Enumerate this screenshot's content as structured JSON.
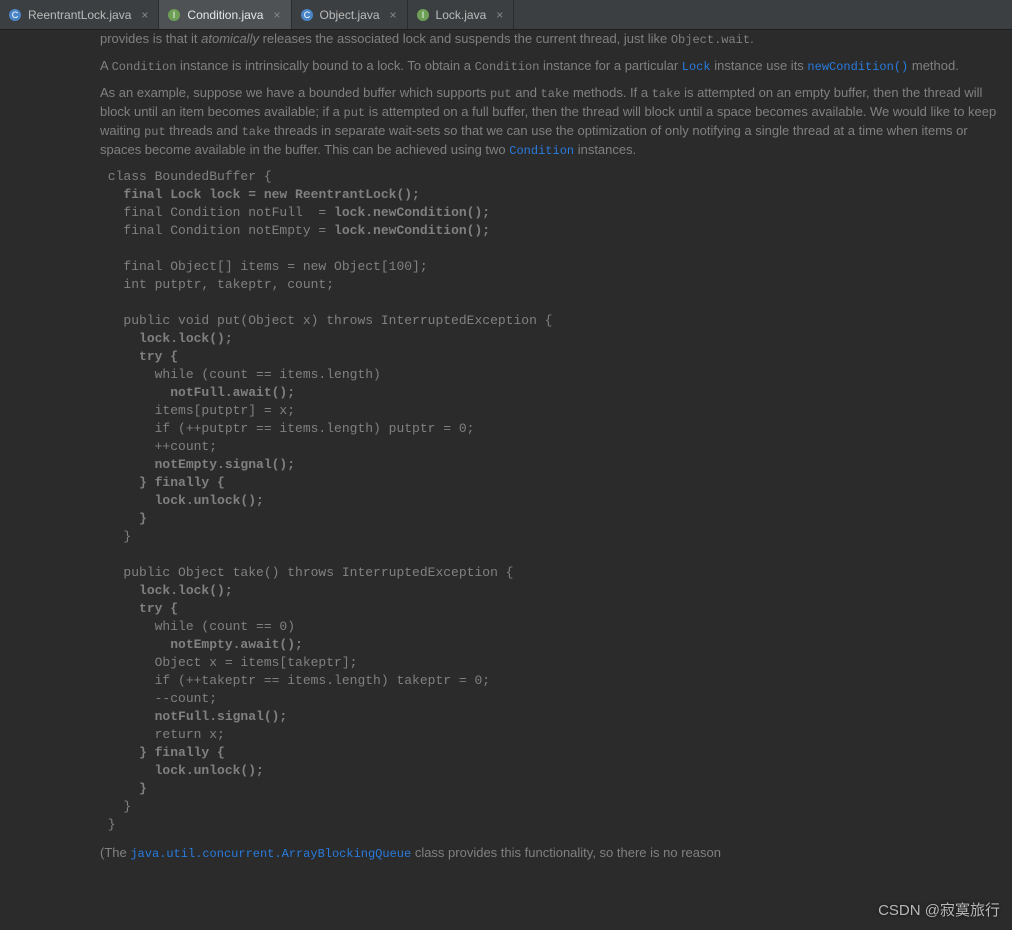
{
  "tabs": [
    {
      "label": "ReentrantLock.java",
      "icon": "class",
      "color": "#4A86C7"
    },
    {
      "label": "Condition.java",
      "icon": "interface",
      "color": "#6E9F56"
    },
    {
      "label": "Object.java",
      "icon": "class",
      "color": "#4A86C7"
    },
    {
      "label": "Lock.java",
      "icon": "interface",
      "color": "#6E9F56"
    }
  ],
  "doc": {
    "p1_a": "provides is that it ",
    "p1_em": "atomically",
    "p1_b": " releases the associated lock and suspends the current thread, just like ",
    "p1_mono": "Object.wait",
    "p1_c": ".",
    "p2_a": "A ",
    "p2_m1": "Condition",
    "p2_b": " instance is intrinsically bound to a lock. To obtain a ",
    "p2_m2": "Condition",
    "p2_c": " instance for a particular ",
    "p2_link": "Lock",
    "p2_d": " instance use its ",
    "p2_link2": "newCondition()",
    "p2_e": " method.",
    "p3_a": "As an example, suppose we have a bounded buffer which supports ",
    "p3_m1": "put",
    "p3_b": " and ",
    "p3_m2": "take",
    "p3_c": " methods. If a ",
    "p3_m3": "take",
    "p3_d": " is attempted on an empty buffer, then the thread will block until an item becomes available; if a ",
    "p3_m4": "put",
    "p3_e": " is attempted on a full buffer, then the thread will block until a space becomes available. We would like to keep waiting ",
    "p3_m5": "put",
    "p3_f": " threads and ",
    "p3_m6": "take",
    "p3_g": " threads in separate wait-sets so that we can use the optimization of only notifying a single thread at a time when items or spaces become available in the buffer. This can be achieved using two ",
    "p3_link": "Condition",
    "p3_h": " instances.",
    "foot_a": "(The ",
    "foot_link": "java.util.concurrent.ArrayBlockingQueue",
    "foot_b": " class provides this functionality, so there is no reason"
  },
  "code": {
    "l01": " class BoundedBuffer {",
    "l02a": "   ",
    "l02b": "final Lock lock = new ReentrantLock();",
    "l03a": "   final Condition notFull  = ",
    "l03b": "lock.newCondition();",
    "l04a": "   final Condition notEmpty = ",
    "l04b": "lock.newCondition();",
    "l05": "",
    "l06": "   final Object[] items = new Object[100];",
    "l07": "   int putptr, takeptr, count;",
    "l08": "",
    "l09": "   public void put(Object x) throws InterruptedException {",
    "l10a": "     ",
    "l10b": "lock.lock();",
    "l11a": "     ",
    "l11b": "try {",
    "l12": "       while (count == items.length)",
    "l13a": "         ",
    "l13b": "notFull.await();",
    "l14": "       items[putptr] = x;",
    "l15": "       if (++putptr == items.length) putptr = 0;",
    "l16": "       ++count;",
    "l17a": "       ",
    "l17b": "notEmpty.signal();",
    "l18a": "     ",
    "l18b": "} finally {",
    "l19a": "       ",
    "l19b": "lock.unlock();",
    "l20a": "     ",
    "l20b": "}",
    "l21": "   }",
    "l22": "",
    "l23": "   public Object take() throws InterruptedException {",
    "l24a": "     ",
    "l24b": "lock.lock();",
    "l25a": "     ",
    "l25b": "try {",
    "l26": "       while (count == 0)",
    "l27a": "         ",
    "l27b": "notEmpty.await();",
    "l28": "       Object x = items[takeptr];",
    "l29": "       if (++takeptr == items.length) takeptr = 0;",
    "l30": "       --count;",
    "l31a": "       ",
    "l31b": "notFull.signal();",
    "l32": "       return x;",
    "l33a": "     ",
    "l33b": "} finally {",
    "l34a": "       ",
    "l34b": "lock.unlock();",
    "l35a": "     ",
    "l35b": "}",
    "l36": "   }",
    "l37": " }"
  },
  "watermark": "CSDN @寂寞旅行"
}
